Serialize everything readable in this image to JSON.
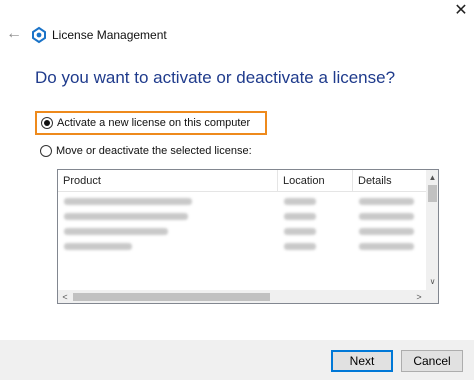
{
  "window": {
    "title": "License Management",
    "close_glyph": "✕",
    "back_glyph": "←",
    "app_icon": "license-app-icon"
  },
  "heading": "Do you want to activate or deactivate a license?",
  "options": [
    {
      "label": "Activate a new license on this computer",
      "selected": true
    },
    {
      "label": "Move or deactivate the selected license:",
      "selected": false
    }
  ],
  "license_list": {
    "columns": [
      "Product",
      "Location",
      "Details"
    ],
    "rows_blurred": true
  },
  "scroll_glyphs": {
    "up": "▲",
    "down": "∨",
    "left": "<",
    "right": ">"
  },
  "buttons": {
    "next": "Next",
    "cancel": "Cancel"
  },
  "colors": {
    "heading": "#1f3b8c",
    "highlight": "#ee8a1c",
    "footer": "#f0f0f0",
    "default_button_border": "#0078d7"
  }
}
